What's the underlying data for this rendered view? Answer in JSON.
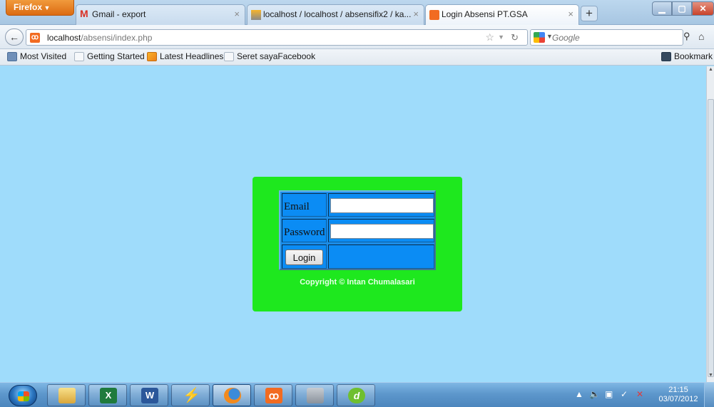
{
  "browser": {
    "menu_label": "Firefox",
    "tabs": [
      {
        "label": "Gmail - export",
        "icon": "gmail-icon"
      },
      {
        "label": "localhost / localhost / absensifix2 / ka...",
        "icon": "phpmyadmin-icon"
      },
      {
        "label": "Login Absensi PT.GSA",
        "icon": "xampp-icon"
      }
    ],
    "url_host": "localhost",
    "url_path": "/absensi/index.php",
    "search_placeholder": "Google",
    "bookmarks": [
      {
        "label": "Most Visited"
      },
      {
        "label": "Getting Started"
      },
      {
        "label": "Latest Headlines"
      },
      {
        "label": "Seret sayaFacebook"
      }
    ],
    "bookmarks_menu_label": "Bookmark"
  },
  "login": {
    "email_label": "Email",
    "email_value": "",
    "password_label": "Password",
    "password_value": "",
    "login_button": "Login",
    "copyright": "Copyright © Intan Chumalasari"
  },
  "taskbar": {
    "apps": [
      {
        "name": "explorer"
      },
      {
        "name": "excel"
      },
      {
        "name": "word"
      },
      {
        "name": "winamp"
      },
      {
        "name": "firefox"
      },
      {
        "name": "xampp"
      },
      {
        "name": "filezilla"
      },
      {
        "name": "dreamweaver"
      }
    ],
    "clock_time": "21:15",
    "clock_date": "03/07/2012"
  },
  "colors": {
    "page_background": "#9fdcfb",
    "login_panel": "#1ee81e",
    "table_cells": "#0b8cf4"
  }
}
